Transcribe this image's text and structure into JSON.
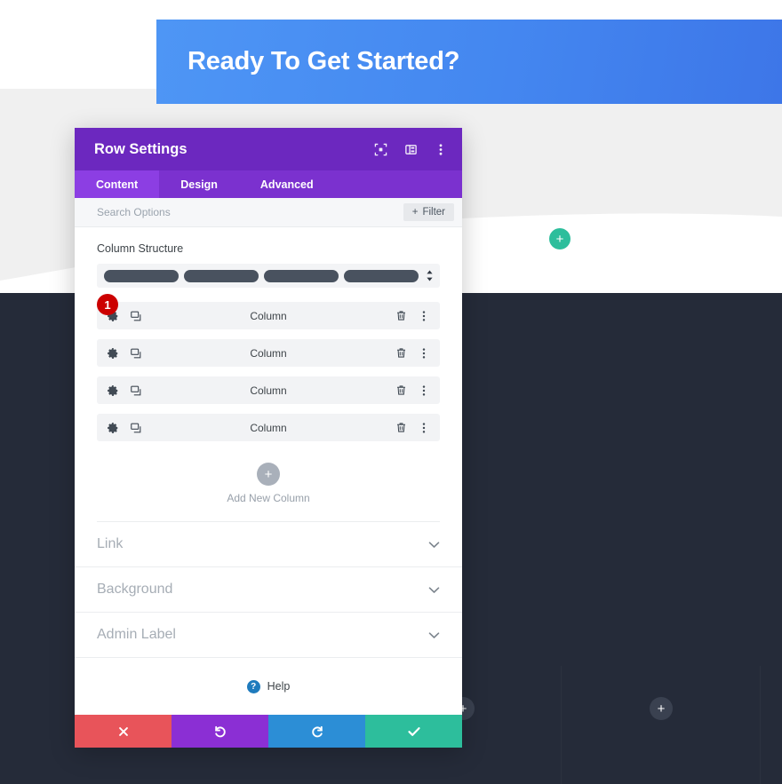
{
  "page": {
    "hero": {
      "title": "Ready To Get Started?",
      "gradient_from": "#4e96f5",
      "gradient_to": "#3d76e8"
    },
    "background": {
      "top_color": "#ffffff",
      "mid_color": "#f0f0f0",
      "dark_color": "#252b39",
      "wave_color": "#ffffff"
    },
    "teal_add_button": {
      "icon": "plus-icon",
      "glyph": "+",
      "color": "#2dbe9c"
    },
    "dark_add_buttons": [
      {
        "icon": "plus-icon",
        "glyph": "+",
        "color": "#3a4150"
      },
      {
        "icon": "plus-icon",
        "glyph": "+",
        "color": "#3a4150"
      }
    ]
  },
  "modal": {
    "header": {
      "title": "Row Settings",
      "bg_color": "#6c28bf",
      "icons": [
        {
          "name": "focus-expand-icon"
        },
        {
          "name": "layout-panel-icon"
        },
        {
          "name": "more-vertical-icon"
        }
      ]
    },
    "tabs": [
      {
        "label": "Content",
        "active": true
      },
      {
        "label": "Design",
        "active": false
      },
      {
        "label": "Advanced",
        "active": false
      }
    ],
    "search": {
      "placeholder": "Search Options",
      "value": "",
      "filter_label": "Filter",
      "filter_icon": "plus-icon"
    },
    "column_structure": {
      "label": "Column Structure",
      "bars": 4,
      "bar_color": "#49525f",
      "stepper_icon": "up-down-arrows-icon"
    },
    "columns": [
      {
        "name": "Column",
        "badge": "1",
        "badge_color": "#cc0000",
        "icons": [
          "gear-icon",
          "duplicate-icon",
          "trash-icon",
          "more-vertical-icon"
        ]
      },
      {
        "name": "Column",
        "badge": "",
        "icons": [
          "gear-icon",
          "duplicate-icon",
          "trash-icon",
          "more-vertical-icon"
        ]
      },
      {
        "name": "Column",
        "badge": "",
        "icons": [
          "gear-icon",
          "duplicate-icon",
          "trash-icon",
          "more-vertical-icon"
        ]
      },
      {
        "name": "Column",
        "badge": "",
        "icons": [
          "gear-icon",
          "duplicate-icon",
          "trash-icon",
          "more-vertical-icon"
        ]
      }
    ],
    "add_column": {
      "label": "Add New Column",
      "icon": "plus-icon",
      "glyph": "+"
    },
    "accordions": [
      {
        "label": "Link",
        "icon": "chevron-down-icon"
      },
      {
        "label": "Background",
        "icon": "chevron-down-icon"
      },
      {
        "label": "Admin Label",
        "icon": "chevron-down-icon"
      }
    ],
    "help": {
      "label": "Help",
      "glyph": "?",
      "color": "#1f7bbd"
    },
    "footer": [
      {
        "name": "cancel",
        "icon": "close-icon",
        "color": "#e8545a"
      },
      {
        "name": "undo",
        "icon": "undo-icon",
        "color": "#8b2fd4"
      },
      {
        "name": "redo",
        "icon": "redo-icon",
        "color": "#2c8ed6"
      },
      {
        "name": "save",
        "icon": "check-icon",
        "color": "#2dbe9c"
      }
    ]
  }
}
